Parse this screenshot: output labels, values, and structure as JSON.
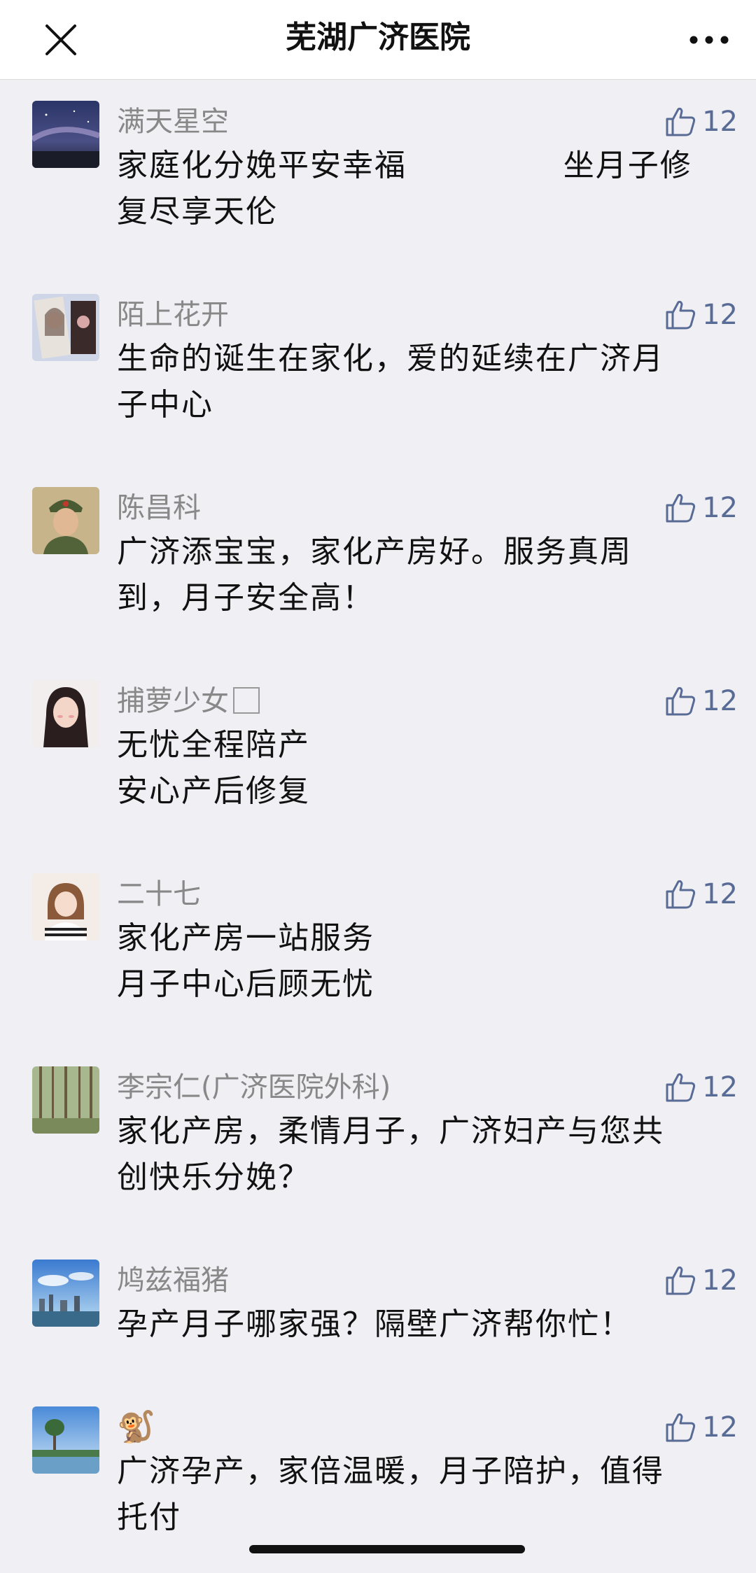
{
  "header": {
    "title": "芜湖广济医院"
  },
  "comments": [
    {
      "nickname": "满天星空",
      "text": "家庭化分娩平安幸福              坐月子修\n复尽享天伦",
      "likes": "12",
      "avatar": "starry-sky-avatar"
    },
    {
      "nickname": "陌上花开",
      "text": "生命的诞生在家化，爱的延续在广济月\n子中心",
      "likes": "12",
      "avatar": "girl-photo-avatar"
    },
    {
      "nickname": "陈昌科",
      "text": "广济添宝宝，家化产房好。服务真周\n到，月子安全高！",
      "likes": "12",
      "avatar": "soldier-portrait-avatar"
    },
    {
      "nickname": "捕萝少女",
      "text": "无忧全程陪产\n安心产后修复",
      "likes": "12",
      "avatar": "girl-selfie-avatar"
    },
    {
      "nickname": "二十七",
      "text": "家化产房一站服务\n月子中心后顾无忧",
      "likes": "12",
      "avatar": "girl-striped-avatar"
    },
    {
      "nickname": "李宗仁(广济医院外科)",
      "text": "家化产房，柔情月子，广济妇产与您共\n创快乐分娩？",
      "likes": "12",
      "avatar": "forest-avatar"
    },
    {
      "nickname": "鸠兹福猪",
      "text": "孕产月子哪家强？隔壁广济帮你忙！",
      "likes": "12",
      "avatar": "city-skyline-avatar"
    },
    {
      "nickname": "🐒",
      "text": "广济孕产，家倍温暖，月子陪护，值得\n托付",
      "likes": "12",
      "avatar": "lake-tree-avatar"
    }
  ]
}
